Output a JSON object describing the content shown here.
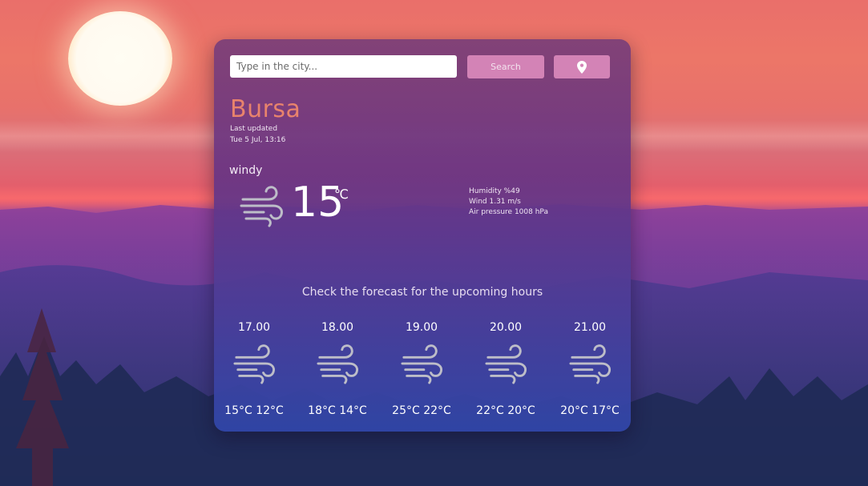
{
  "search": {
    "placeholder": "Type in the city...",
    "button_label": "Search",
    "location_icon": "map-pin-icon"
  },
  "current": {
    "city": "Bursa",
    "updated_label": "Last updated",
    "updated_time": "Tue 5 Jul, 13:16",
    "condition": "windy",
    "icon": "wind-icon",
    "temperature": "15",
    "unit": "℃",
    "humidity": "Humidity %49",
    "wind": "Wind 1.31 m/s",
    "pressure": "Air pressure 1008 hPa"
  },
  "forecast": {
    "title": "Check the forecast for the upcoming hours",
    "hours": [
      {
        "time": "17.00",
        "temps": "15°C 12°C",
        "icon": "wind-icon"
      },
      {
        "time": "18.00",
        "temps": "18°C 14°C",
        "icon": "wind-icon"
      },
      {
        "time": "19.00",
        "temps": "25°C 22°C",
        "icon": "wind-icon"
      },
      {
        "time": "20.00",
        "temps": "22°C 20°C",
        "icon": "wind-icon"
      },
      {
        "time": "21.00",
        "temps": "20°C 17°C",
        "icon": "wind-icon"
      }
    ]
  },
  "colors": {
    "city": "#e8836c",
    "button": "#d383b6",
    "icon": "#bdbdc8"
  }
}
